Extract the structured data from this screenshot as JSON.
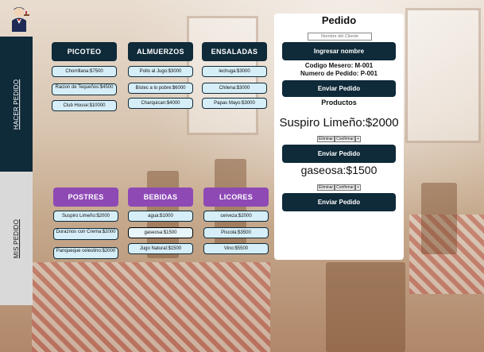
{
  "sidebar": {
    "tabs": [
      {
        "label": "HACER PEDIDO",
        "active": true
      },
      {
        "label": "MIS PEDIDO",
        "active": false
      }
    ]
  },
  "categories": [
    {
      "label": "PICOTEO",
      "color": "#0f2a39",
      "items": [
        "Chorrillana:$7500",
        "Racion de Tequeños:$4500",
        "Club House:$10000"
      ]
    },
    {
      "label": "ALMUERZOS",
      "color": "#0f2a39",
      "items": [
        "Pollo al Jugo:$3000",
        "Bistec a lo pobre:$6000",
        "Charquican:$4000"
      ]
    },
    {
      "label": "ENSALADAS",
      "color": "#0f2a39",
      "items": [
        "lechuga:$3000",
        "Chilena:$3000",
        "Papas Mayo:$3000"
      ]
    },
    {
      "label": "POSTRES",
      "color": "#8e49b5",
      "items": [
        "Suspiro Limeño:$2000",
        "Duraznos con Crema:$2000",
        "Panqueque celestino:$2000"
      ]
    },
    {
      "label": "BEBIDAS",
      "color": "#8e49b5",
      "items": [
        "agua:$1000",
        "gaseosa:$1500",
        "Jugo Natural:$1500"
      ]
    },
    {
      "label": "LICORES",
      "color": "#8e49b5",
      "items": [
        "cerveza:$2000",
        "Piscola:$3500",
        "Vino:$5500"
      ]
    }
  ],
  "order_panel": {
    "title": "Pedido",
    "name_placeholder": "Nombre del Cliente",
    "enter_name_label": "Ingresar nombre",
    "waiter_code": "Codigo Mesero: M-001",
    "order_number": "Numero de Pedido: P-001",
    "send_label": "Enviar Pedido",
    "products_heading": "Productos",
    "items": [
      {
        "name": "Suspiro Limeño:$2000",
        "remove_label": "Eliminar",
        "confirm_label": "Confirmar",
        "plus_label": "+",
        "send_label": "Enviar Pedido"
      },
      {
        "name": "gaseosa:$1500",
        "remove_label": "Eliminar",
        "confirm_label": "Confirmar",
        "plus_label": "+",
        "send_label": "Enviar Pedido"
      }
    ]
  },
  "colors": {
    "navy": "#0f2a39",
    "purple": "#8e49b5",
    "item_bg": "#d6eef8",
    "inactive_tab": "#d9d9d9"
  },
  "icons": {
    "logo": "waiter-logo-icon"
  }
}
